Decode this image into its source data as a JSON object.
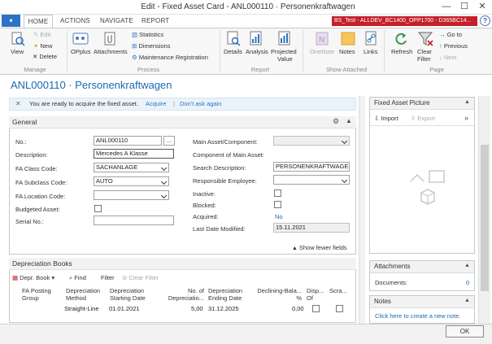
{
  "window": {
    "title": "Edit - Fixed Asset Card - ANL000110 · Personenkraftwagen",
    "minimize": "—",
    "maximize": "☐",
    "close": "✕"
  },
  "menu": {
    "app": "▾",
    "tabs": [
      "HOME",
      "ACTIONS",
      "NAVIGATE",
      "REPORT"
    ],
    "env": "BS_Test - ALLDEV_BC1400_OPP1700 - D365BC14...",
    "help": "?"
  },
  "ribbon": {
    "view": "View",
    "edit": "Edit",
    "new": "New",
    "delete": "Delete",
    "group_manage": "Manage",
    "opplus": "OPplus",
    "attachments": "Attachments",
    "statistics": "Statistics",
    "dimensions": "Dimensions",
    "maintenance": "Maintenance Registration",
    "group_process": "Process",
    "details": "Details",
    "analysis": "Analysis",
    "projected1": "Projected",
    "projected2": "Value",
    "group_report": "Report",
    "onenote": "OneNote",
    "notes": "Notes",
    "links": "Links",
    "group_attached": "Show Attached",
    "refresh": "Refresh",
    "clear1": "Clear",
    "clear2": "Filter",
    "goto": "Go to",
    "previous": "Previous",
    "next": "Next",
    "group_page": "Page"
  },
  "page": {
    "title": "ANL000110 · Personenkraftwagen"
  },
  "banner": {
    "text": "You are ready to acquire the fixed asset.",
    "acquire": "Acquire",
    "sep": "|",
    "dont_ask": "Don't ask again"
  },
  "general": {
    "title": "General",
    "no_label": "No.:",
    "no": "ANL000110",
    "no_btn": "...",
    "desc_label": "Description:",
    "desc": "Mercedes A Klasse",
    "class_label": "FA Class Code:",
    "class": "SACHANLAGE",
    "subclass_label": "FA Subclass Code:",
    "subclass": "AUTO",
    "location_label": "FA Location Code:",
    "location": "",
    "budgeted_label": "Budgeted Asset:",
    "serial_label": "Serial No.:",
    "serial": "",
    "main_label": "Main Asset/Component:",
    "main": "",
    "comp_label": "Component of Main Asset:",
    "search_label": "Search Description:",
    "search": "PERSONENKRAFTWAGEN",
    "resp_label": "Responsible Employee:",
    "resp": "",
    "inactive_label": "Inactive:",
    "blocked_label": "Blocked:",
    "acquired_label": "Acquired:",
    "acquired": "No",
    "lastdate_label": "Last Date Modified:",
    "lastdate": "15.11.2021",
    "fewer": "Show fewer fields"
  },
  "depreciation": {
    "title": "Depreciation Books",
    "deprbook": "Depr. Book",
    "find": "Find",
    "filter": "Filter",
    "clear": "Clear Filter",
    "headers": [
      "FA Posting Group",
      "Depreciation Method",
      "Depreciation Starting Date",
      "No. of Depreciatio...",
      "Depreciation Ending Date",
      "Declining-Bala... %",
      "Disp... Of",
      "Scra..."
    ],
    "row": {
      "group": "",
      "method": "Straight-Line",
      "start": "01.01.2021",
      "years": "5,00",
      "end": "31.12.2025",
      "declining": "0,00"
    }
  },
  "right": {
    "picture_title": "Fixed Asset Picture",
    "import": "Import",
    "export": "Export",
    "attachments_title": "Attachments",
    "documents_label": "Documents:",
    "documents": "0",
    "notes_title": "Notes",
    "notes_link": "Click here to create a new note."
  },
  "footer": {
    "ok": "OK"
  },
  "colors": {
    "accent": "#1a6ab0",
    "env": "#c4202a",
    "app": "#2b73c5"
  }
}
